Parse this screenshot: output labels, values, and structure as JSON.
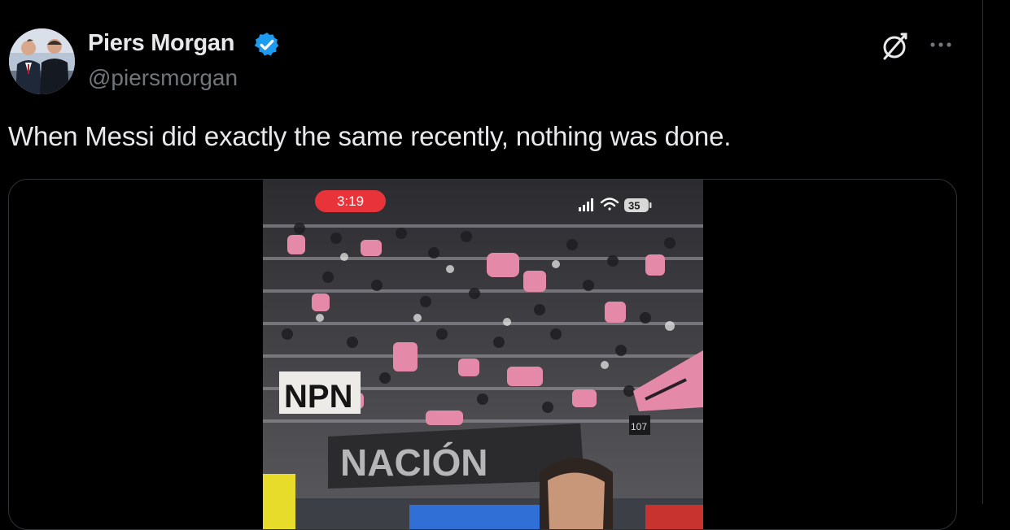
{
  "author": {
    "display_name": "Piers Morgan",
    "handle": "@piersmorgan",
    "verified_color": "#1d9bf0"
  },
  "tweet": {
    "text": "When Messi did exactly the same recently, nothing was done."
  },
  "icons": {
    "grok": "grok-icon",
    "more": "more-icon",
    "verified": "verified-badge-icon"
  },
  "video": {
    "timer": "3:19",
    "battery": "35",
    "banner_text_1": "NPN",
    "banner_text_2": "NACIÓN",
    "section_number": "107"
  },
  "colors": {
    "background": "#000000",
    "text_primary": "#e7e9ea",
    "text_secondary": "#71767b",
    "timer_pill": "#e8333a",
    "fan_pink": "#e48aa8"
  }
}
